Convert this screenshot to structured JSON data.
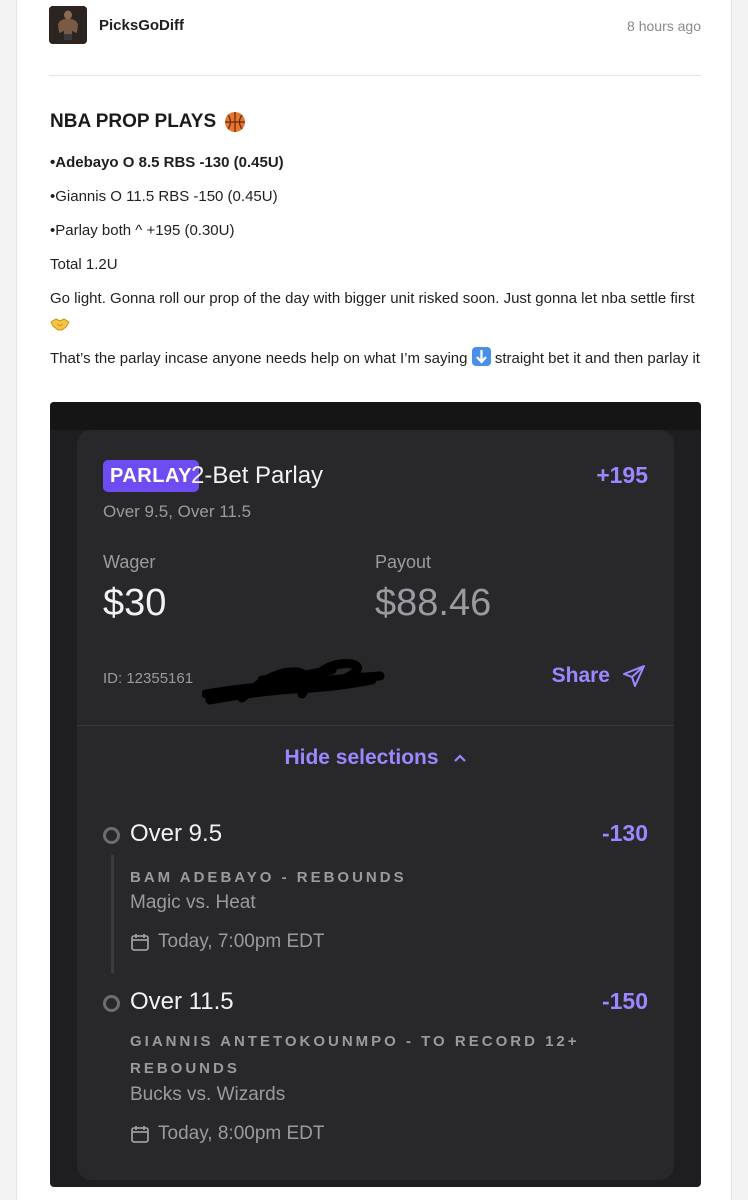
{
  "post": {
    "username": "PicksGoDiff",
    "timestamp": "8 hours ago",
    "title": "NBA PROP PLAYS",
    "title_icon": "basketball-icon",
    "lines": [
      "•Adebayo O 8.5 RBS -130 (0.45U)",
      "•Giannis O 11.5 RBS -150 (0.45U)",
      "•Parlay both ^ +195 (0.30U)",
      "Total 1.2U"
    ],
    "paragraph1": "Go light. Gonna roll our prop of the day with bigger unit risked soon. Just gonna let nba settle first",
    "paragraph1_icon": "handshake-icon",
    "paragraph2_a": "That’s the parlay incase anyone needs help on what I’m saying",
    "paragraph2_icon": "down-arrow-icon",
    "paragraph2_b": "straight bet it and then parlay it"
  },
  "betslip": {
    "badge": "PARLAY",
    "title": "2-Bet Parlay",
    "odds": "+195",
    "subtitle": "Over 9.5, Over 11.5",
    "wager_label": "Wager",
    "wager_value": "$30",
    "payout_label": "Payout",
    "payout_value": "$88.46",
    "id_text": "ID: 12355161",
    "share_label": "Share",
    "hide_selections_label": "Hide selections",
    "legs": [
      {
        "selection": "Over 9.5",
        "odds": "-130",
        "market": "BAM ADEBAYO - REBOUNDS",
        "game": "Magic vs. Heat",
        "time": "Today, 7:00pm EDT"
      },
      {
        "selection": "Over 11.5",
        "odds": "-150",
        "market": "GIANNIS ANTETOKOUNMPO - TO RECORD 12+ REBOUNDS",
        "game": "Bucks vs. Wizards",
        "time": "Today, 8:00pm EDT"
      }
    ]
  },
  "colors": {
    "accent": "#6d4cf2",
    "accent_text": "#9d86ff",
    "card_bg": "#28282b"
  }
}
